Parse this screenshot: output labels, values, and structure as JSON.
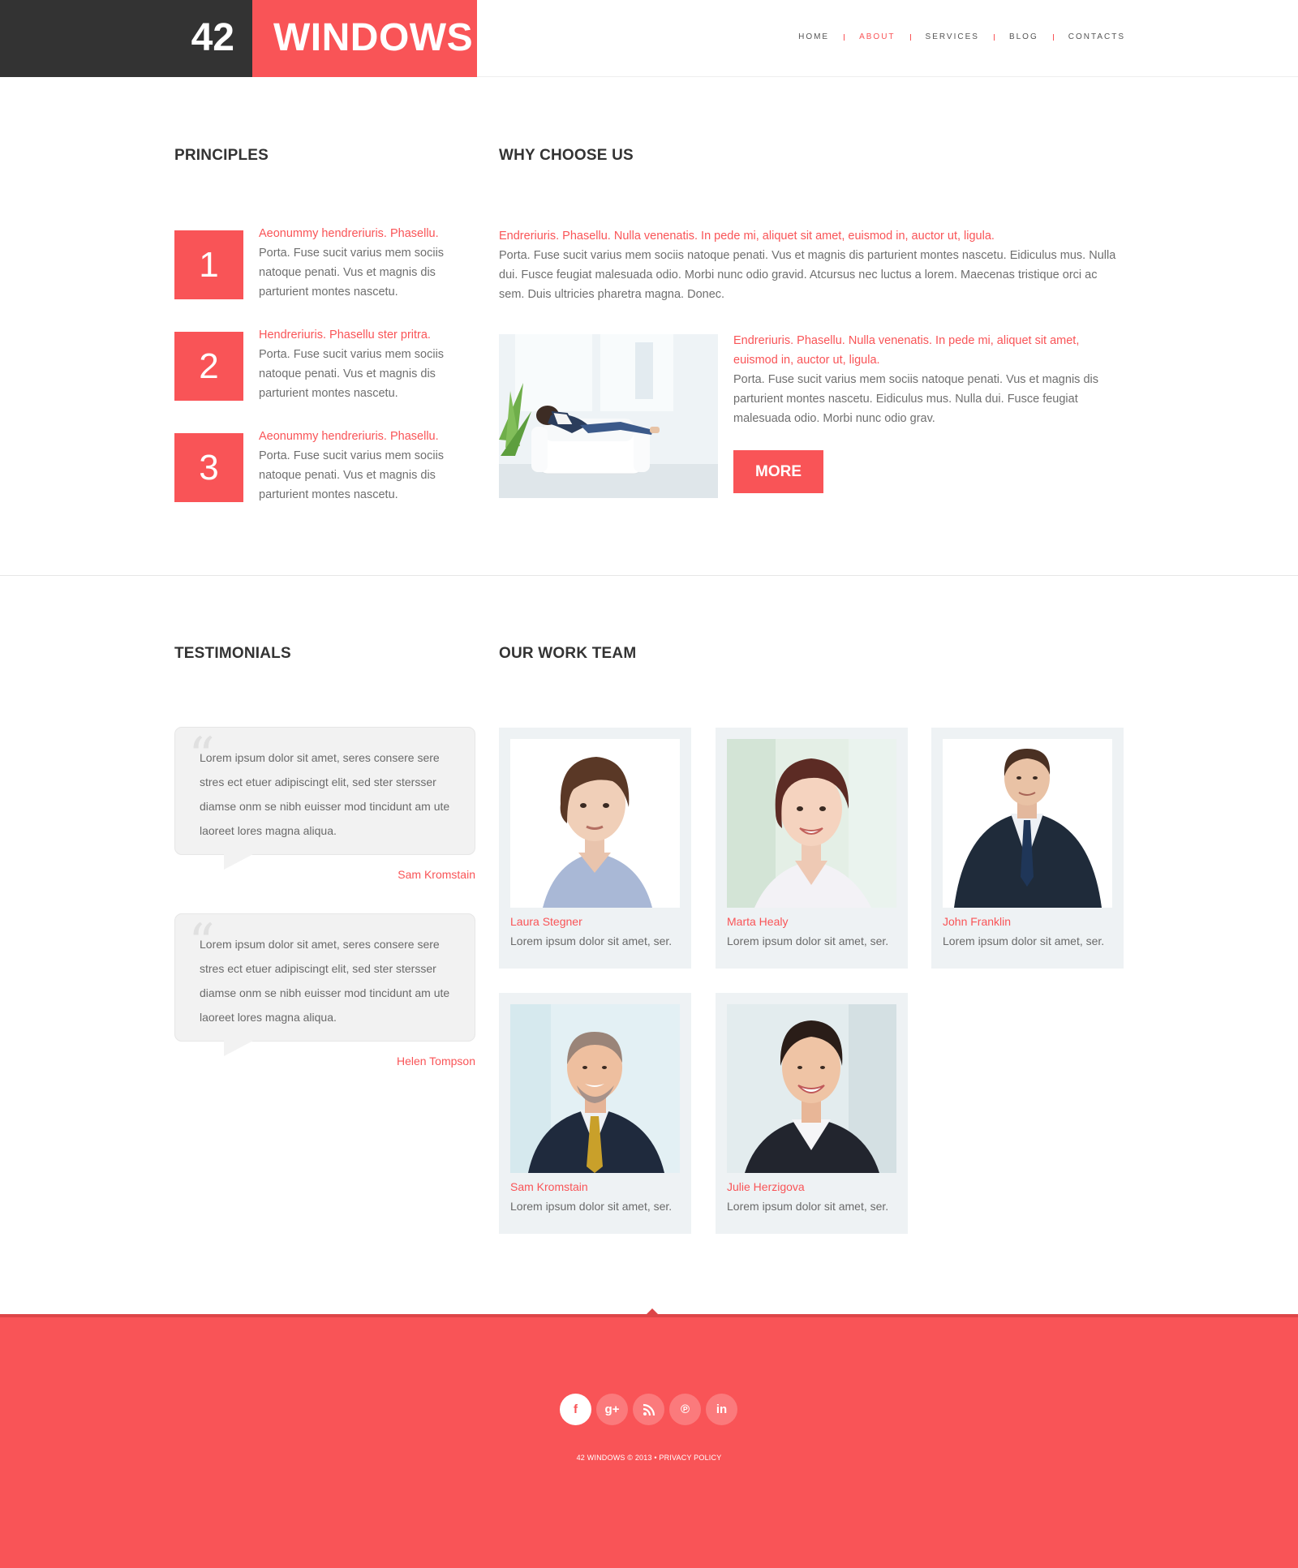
{
  "brand": {
    "number": "42",
    "word": "WINDOWS"
  },
  "nav": {
    "items": [
      {
        "label": "HOME"
      },
      {
        "label": "ABOUT"
      },
      {
        "label": "SERVICES"
      },
      {
        "label": "BLOG"
      },
      {
        "label": "CONTACTS"
      }
    ],
    "active": "ABOUT"
  },
  "principles": {
    "heading": "PRINCIPLES",
    "items": [
      {
        "num": "1",
        "title": "Aeonummy hendreriuris. Phasellu.",
        "text": "Porta. Fuse sucit varius mem sociis natoque penati. Vus et magnis dis parturient montes nascetu."
      },
      {
        "num": "2",
        "title": "Hendreriuris. Phasellu ster pritra.",
        "text": "Porta. Fuse sucit varius mem sociis natoque penati. Vus et magnis dis parturient montes nascetu."
      },
      {
        "num": "3",
        "title": "Aeonummy hendreriuris. Phasellu.",
        "text": "Porta. Fuse sucit varius mem sociis natoque penati. Vus et magnis dis parturient montes nascetu."
      }
    ]
  },
  "why": {
    "heading": "WHY CHOOSE US",
    "intro_lead": "Endreriuris. Phasellu. Nulla venenatis. In pede mi, aliquet sit amet, euismod in, auctor ut, ligula.",
    "intro_text": "Porta. Fuse sucit varius mem sociis natoque penati. Vus et magnis dis parturient montes nascetu. Eidiculus mus. Nulla dui. Fusce feugiat malesuada odio. Morbi nunc odio gravid. Atcursus nec luctus a lorem. Maecenas tristique orci ac sem. Duis ultricies pharetra magna. Donec.",
    "side_lead": "Endreriuris. Phasellu. Nulla venenatis. In pede mi, aliquet sit amet, euismod in, auctor ut, ligula.",
    "side_text": "Porta. Fuse sucit varius mem sociis natoque penati. Vus et magnis dis parturient montes nascetu. Eidiculus mus. Nulla dui. Fusce feugiat malesuada odio. Morbi nunc odio grav.",
    "more_label": "MORE"
  },
  "testimonials": {
    "heading": "TESTIMONIALS",
    "items": [
      {
        "text": "Lorem ipsum dolor sit amet, seres consere sere stres ect etuer adipiscingt elit, sed ster stersser diamse onm se nibh euisser mod tincidunt am ute laoreet lores magna aliqua.",
        "author": "Sam Kromstain"
      },
      {
        "text": "Lorem ipsum dolor sit amet, seres consere sere stres ect etuer adipiscingt elit, sed ster stersser diamse onm se nibh euisser mod tincidunt am ute laoreet lores magna aliqua.",
        "author": "Helen Tompson"
      }
    ]
  },
  "team": {
    "heading": "OUR WORK TEAM",
    "members": [
      {
        "name": "Laura Stegner",
        "desc": "Lorem ipsum dolor sit amet, ser."
      },
      {
        "name": "Marta Healy",
        "desc": "Lorem ipsum dolor sit amet, ser."
      },
      {
        "name": "John Franklin",
        "desc": "Lorem ipsum dolor sit amet, ser."
      },
      {
        "name": "Sam Kromstain",
        "desc": "Lorem ipsum dolor sit amet, ser."
      },
      {
        "name": "Julie Herzigova",
        "desc": "Lorem ipsum dolor sit amet, ser."
      }
    ]
  },
  "footer": {
    "socials": [
      {
        "icon": "facebook-icon",
        "glyph": "f"
      },
      {
        "icon": "google-plus-icon",
        "glyph": "g+"
      },
      {
        "icon": "rss-icon",
        "glyph": ""
      },
      {
        "icon": "pinterest-icon",
        "glyph": "℗"
      },
      {
        "icon": "linkedin-icon",
        "glyph": "in"
      }
    ],
    "copyright": "42 WINDOWS © 2013 • PRIVACY POLICY"
  },
  "colors": {
    "accent": "#f95457",
    "dark": "#333333",
    "card_bg": "#eef2f4"
  }
}
